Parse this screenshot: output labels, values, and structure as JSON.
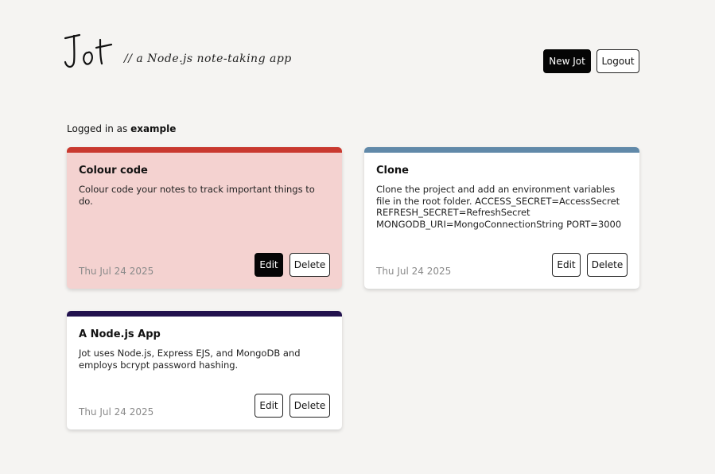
{
  "app": {
    "logo_text": "Jot",
    "tagline": "// a Node.js note-taking app"
  },
  "header": {
    "new_label": "New Jot",
    "logout_label": "Logout"
  },
  "session": {
    "prefix": "Logged in as",
    "username": "example"
  },
  "notes": [
    {
      "title": "Colour code",
      "body": "Colour code your notes to track important things to do.",
      "date": "Thu Jul 24 2025",
      "accent": "#c9392f",
      "background": "#f4d2d0",
      "edit_label": "Edit",
      "delete_label": "Delete",
      "edit_active": true
    },
    {
      "title": "Clone",
      "body": "Clone the project and add an environment variables file in the root folder. ACCESS_SECRET=AccessSecret REFRESH_SECRET=RefreshSecret MONGODB_URI=MongoConnectionString PORT=3000",
      "date": "Thu Jul 24 2025",
      "accent": "#6189a9",
      "background": "#ffffff",
      "edit_label": "Edit",
      "delete_label": "Delete",
      "edit_active": false
    },
    {
      "title": "A Node.js App",
      "body": "Jot uses Node.js, Express EJS, and MongoDB and employs bcrypt password hashing.",
      "date": "Thu Jul 24 2025",
      "accent": "#22124e",
      "background": "#ffffff",
      "edit_label": "Edit",
      "delete_label": "Delete",
      "edit_active": false
    }
  ]
}
